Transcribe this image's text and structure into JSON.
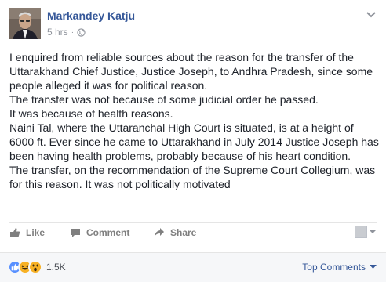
{
  "post": {
    "author": "Markandey Katju",
    "time": "5 hrs",
    "separator": "·",
    "paragraphs": [
      "I enquired from reliable sources about the reason for the transfer of the Uttarakhand Chief Justice, Justice Joseph, to Andhra Pradesh, since some people alleged it was for political reason.",
      "The transfer was not because of some judicial order he passed.",
      "It was because of health reasons.",
      "Naini Tal, where the Uttaranchal High Court is situated, is at a height of 6000 ft. Ever since he came to Uttarakhand in July 2014 Justice Joseph has been having health problems, probably because of his heart condition.",
      "The transfer, on the recommendation of the Supreme Court Collegium, was for this reason. It was not politically motivated"
    ]
  },
  "actions": {
    "like": "Like",
    "comment": "Comment",
    "share": "Share"
  },
  "footer": {
    "reaction_count": "1.5K",
    "top_comments": "Top Comments"
  },
  "icons": {
    "audience": "globe-icon",
    "menu": "chevron-down-icon",
    "like": "thumbs-up-icon",
    "comment": "comment-bubble-icon",
    "share": "share-arrow-icon",
    "reactions": [
      "like-reaction-icon",
      "haha-reaction-icon",
      "wow-reaction-icon"
    ],
    "sort": "caret-down-icon"
  },
  "colors": {
    "author_link": "#365899",
    "meta_text": "#90949c",
    "action_text": "#7f7f7f",
    "like_reaction": "#5890ff",
    "emoji_reaction": "#f7b125"
  }
}
